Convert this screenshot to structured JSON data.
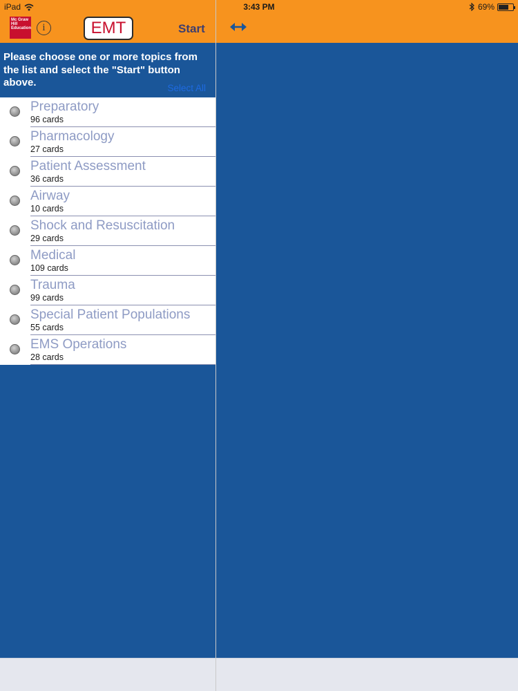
{
  "status": {
    "device": "iPad",
    "time": "3:43 PM",
    "battery": "69%",
    "battery_level": 0.69
  },
  "nav": {
    "logo_text": "Mc Graw Hill Education",
    "info_icon": "info-icon",
    "title": "EMT",
    "start_label": "Start",
    "expand_icon": "expand-arrows-icon"
  },
  "colors": {
    "bar": "#f7931e",
    "background": "#1a5699",
    "topic_title": "#8e9bc4",
    "link": "#1e6ae0",
    "brand_red": "#c8102e"
  },
  "intro": {
    "text": "Please choose one or more topics from the list and select the \"Start\" button above.",
    "select_all": "Select All"
  },
  "topics": [
    {
      "title": "Preparatory",
      "count": "96 cards"
    },
    {
      "title": "Pharmacology",
      "count": "27 cards"
    },
    {
      "title": "Patient Assessment",
      "count": "36 cards"
    },
    {
      "title": "Airway",
      "count": "10 cards"
    },
    {
      "title": "Shock and Resuscitation",
      "count": "29 cards"
    },
    {
      "title": "Medical",
      "count": "109 cards"
    },
    {
      "title": "Trauma",
      "count": "99 cards"
    },
    {
      "title": "Special Patient Populations",
      "count": "55 cards"
    },
    {
      "title": "EMS Operations",
      "count": "28 cards"
    }
  ]
}
